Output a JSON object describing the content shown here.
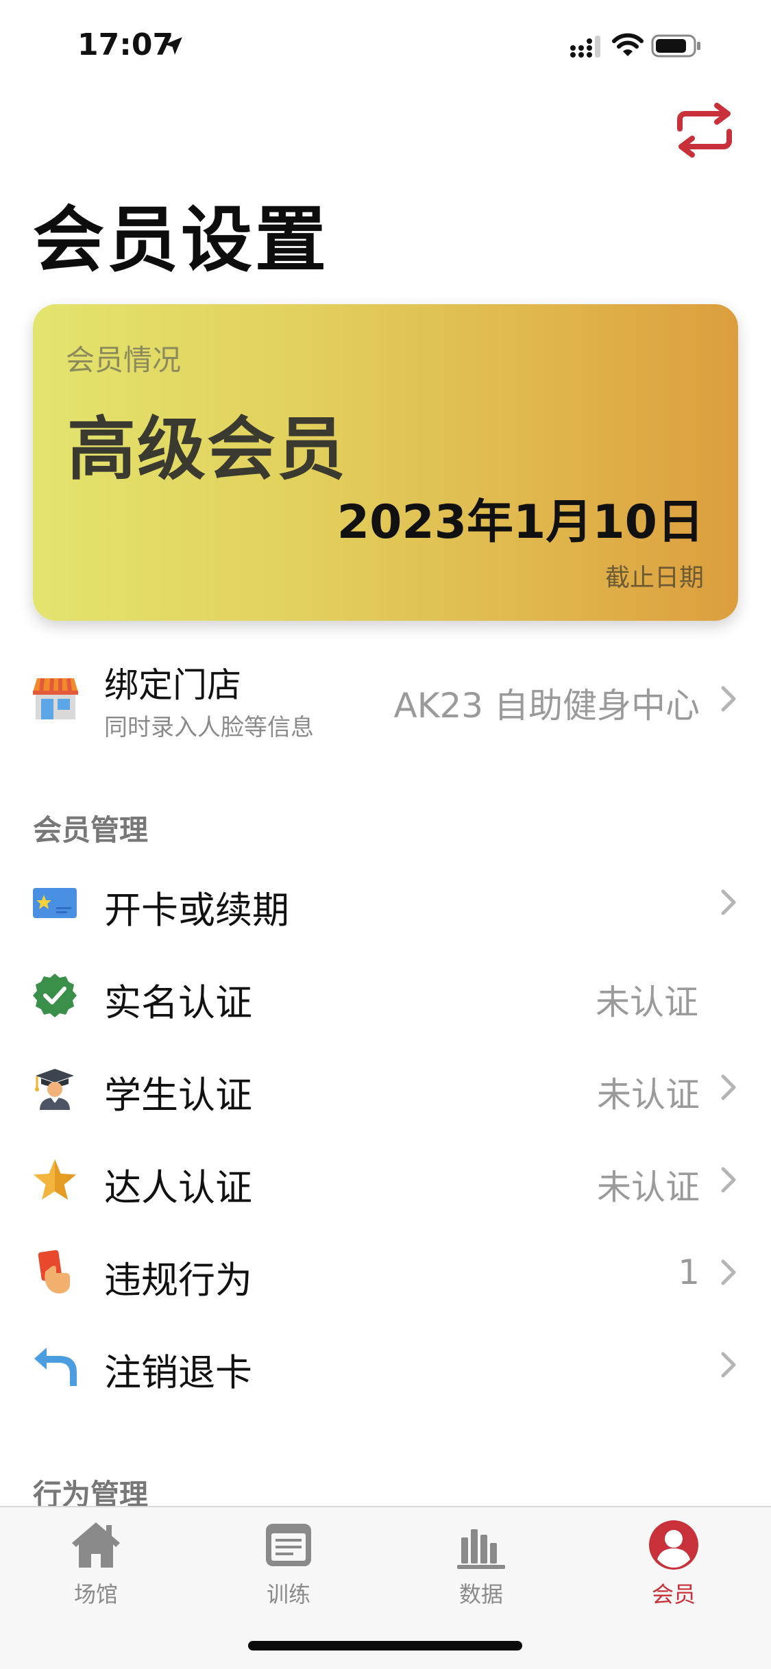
{
  "status_bar": {
    "time": "17:07"
  },
  "page": {
    "title": "会员设置"
  },
  "member_card": {
    "caption": "会员情况",
    "level": "高级会员",
    "expiry_date": "2023年1月10日",
    "expiry_caption": "截止日期"
  },
  "store": {
    "title": "绑定门店",
    "subtitle": "同时录入人脸等信息",
    "value": "AK23 自助健身中心"
  },
  "member_management": {
    "header": "会员管理",
    "items": [
      {
        "label": "开卡或续期",
        "value": "",
        "icon": "membership-card-icon"
      },
      {
        "label": "实名认证",
        "value": "未认证",
        "icon": "verified-badge-icon"
      },
      {
        "label": "学生认证",
        "value": "未认证",
        "icon": "graduate-icon"
      },
      {
        "label": "达人认证",
        "value": "未认证",
        "icon": "star-icon"
      },
      {
        "label": "违规行为",
        "value": "1",
        "icon": "red-card-icon"
      },
      {
        "label": "注销退卡",
        "value": "",
        "icon": "return-arrow-icon"
      }
    ]
  },
  "behavior_management": {
    "header": "行为管理"
  },
  "tab_bar": {
    "tabs": [
      {
        "label": "场馆",
        "icon": "home-icon",
        "active": false
      },
      {
        "label": "训练",
        "icon": "notepad-icon",
        "active": false
      },
      {
        "label": "数据",
        "icon": "bar-chart-icon",
        "active": false
      },
      {
        "label": "会员",
        "icon": "user-icon",
        "active": true
      }
    ]
  },
  "colors": {
    "accent": "#c8303a",
    "card_gradient_start": "#e3e46e",
    "card_gradient_end": "#dc9e3d"
  }
}
